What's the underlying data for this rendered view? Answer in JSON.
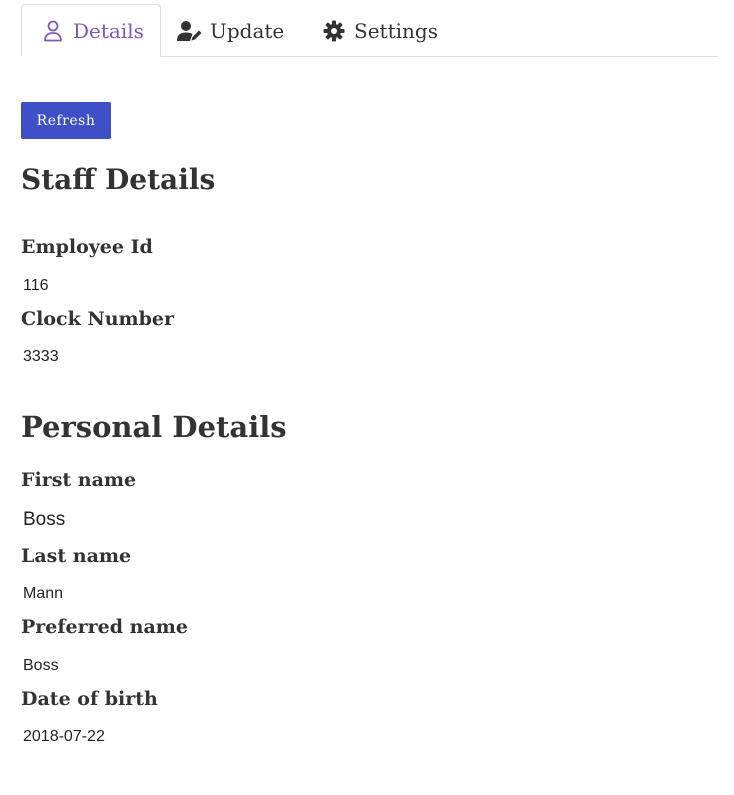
{
  "tabs": [
    {
      "label": "Details",
      "icon": "user-outline-icon",
      "active": true
    },
    {
      "label": "Update",
      "icon": "user-edit-icon",
      "active": false
    },
    {
      "label": "Settings",
      "icon": "gear-icon",
      "active": false
    }
  ],
  "toolbar": {
    "refresh_label": "Refresh"
  },
  "staff_details": {
    "title": "Staff Details",
    "employee_id_label": "Employee Id",
    "employee_id_value": "116",
    "clock_number_label": "Clock Number",
    "clock_number_value": "3333"
  },
  "personal_details": {
    "title": "Personal Details",
    "first_name_label": "First name",
    "first_name_value": "Boss",
    "last_name_label": "Last name",
    "last_name_value": "Mann",
    "preferred_name_label": "Preferred name",
    "preferred_name_value": "Boss",
    "dob_label": "Date of birth",
    "dob_value": "2018-07-22"
  },
  "colors": {
    "accent": "#7e57c2",
    "button": "#3f4fc8",
    "text": "#333333",
    "border": "#dddddd"
  }
}
